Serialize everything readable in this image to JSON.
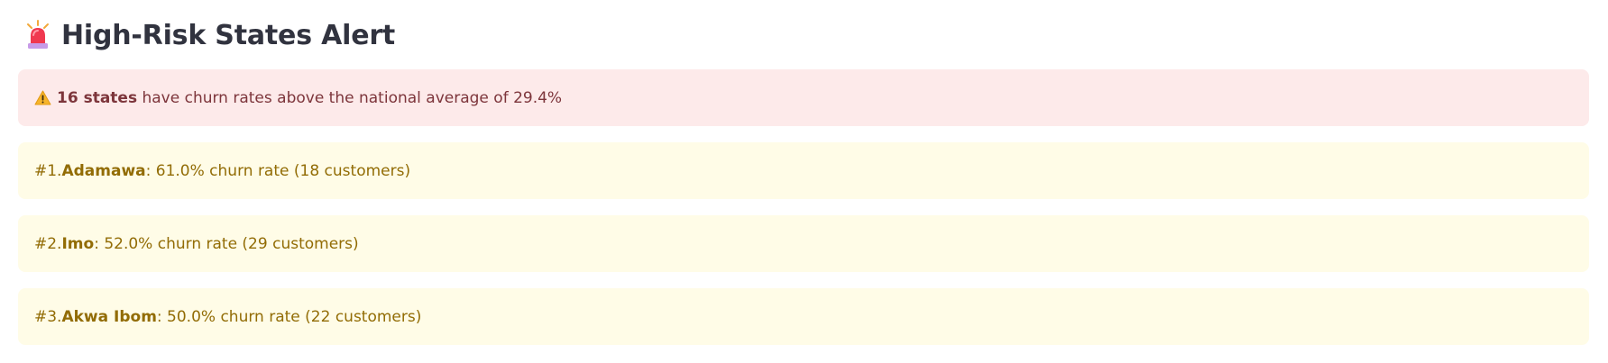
{
  "header": {
    "icon": "siren-icon",
    "title": "High-Risk States Alert"
  },
  "summary": {
    "icon": "warning-icon",
    "count_text": "16 states",
    "rest_text": " have churn rates above the national average of 29.4%"
  },
  "states": [
    {
      "rank": "#1. ",
      "name": "Adamawa",
      "detail": ": 61.0% churn rate (18 customers)"
    },
    {
      "rank": "#2. ",
      "name": "Imo",
      "detail": ": 52.0% churn rate (29 customers)"
    },
    {
      "rank": "#3. ",
      "name": "Akwa Ibom",
      "detail": ": 50.0% churn rate (22 customers)"
    }
  ],
  "colors": {
    "error_bg": "#fdeaea",
    "error_text": "#7d353b",
    "warning_bg": "#fffce7",
    "warning_text": "#926c05"
  }
}
